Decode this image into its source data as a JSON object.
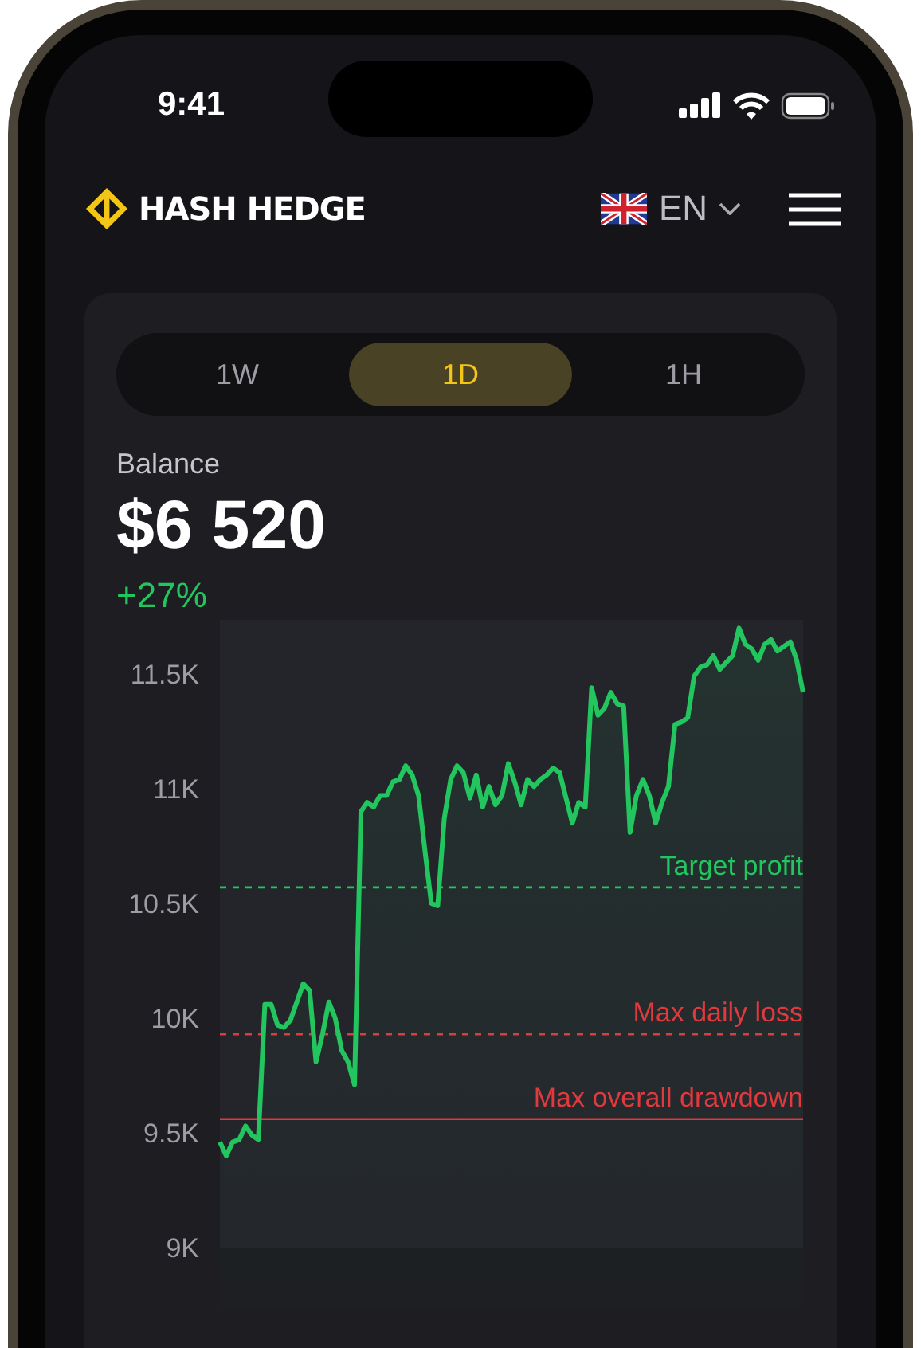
{
  "status_bar": {
    "time": "9:41"
  },
  "header": {
    "logo": "HASH HEDGE",
    "language": "EN"
  },
  "tabs": [
    {
      "label": "1W",
      "selected": false
    },
    {
      "label": "1D",
      "selected": true
    },
    {
      "label": "1H",
      "selected": false
    }
  ],
  "balance": {
    "label": "Balance",
    "amount": "$6 520",
    "change": "+27%"
  },
  "chart": {
    "chart_data": {
      "type": "area",
      "ylim": [
        9000,
        11750
      ],
      "yticks": [
        {
          "value": 9000,
          "label": "9K"
        },
        {
          "value": 9500,
          "label": "9.5K"
        },
        {
          "value": 10000,
          "label": "10K"
        },
        {
          "value": 10500,
          "label": "10.5K"
        },
        {
          "value": 11000,
          "label": "11K"
        },
        {
          "value": 11500,
          "label": "11.5K"
        }
      ],
      "series": [
        {
          "color": "#22c55e",
          "values": [
            9460,
            9400,
            9460,
            9470,
            9530,
            9490,
            9470,
            10060,
            10060,
            9970,
            9960,
            9990,
            10070,
            10150,
            10120,
            9810,
            9930,
            10070,
            10000,
            9860,
            9810,
            9710,
            10900,
            10940,
            10920,
            10970,
            10970,
            11030,
            11040,
            11100,
            11060,
            10970,
            10730,
            10500,
            10490,
            10870,
            11040,
            11100,
            11070,
            10960,
            11060,
            10920,
            11010,
            10930,
            10970,
            11110,
            11030,
            10930,
            11040,
            11010,
            11040,
            11060,
            11090,
            11070,
            10960,
            10850,
            10940,
            10920,
            11440,
            11320,
            11350,
            11420,
            11370,
            11360,
            10810,
            10970,
            11040,
            10970,
            10850,
            10940,
            11010,
            11280,
            11290,
            11310,
            11490,
            11530,
            11540,
            11580,
            11520,
            11550,
            11580,
            11700,
            11630,
            11610,
            11560,
            11630,
            11650,
            11600,
            11620,
            11640,
            11560,
            11420
          ]
        }
      ],
      "ref_lines": [
        {
          "axis": "y",
          "label": "Target profit",
          "value": 10570,
          "color": "#22c55e"
        },
        {
          "axis": "y",
          "label": "Max daily loss",
          "value": 9930,
          "color": "#e0393e"
        },
        {
          "axis": "y",
          "label": "Max overall drawdown",
          "value": 9560,
          "color": "#e0393e"
        }
      ]
    }
  }
}
